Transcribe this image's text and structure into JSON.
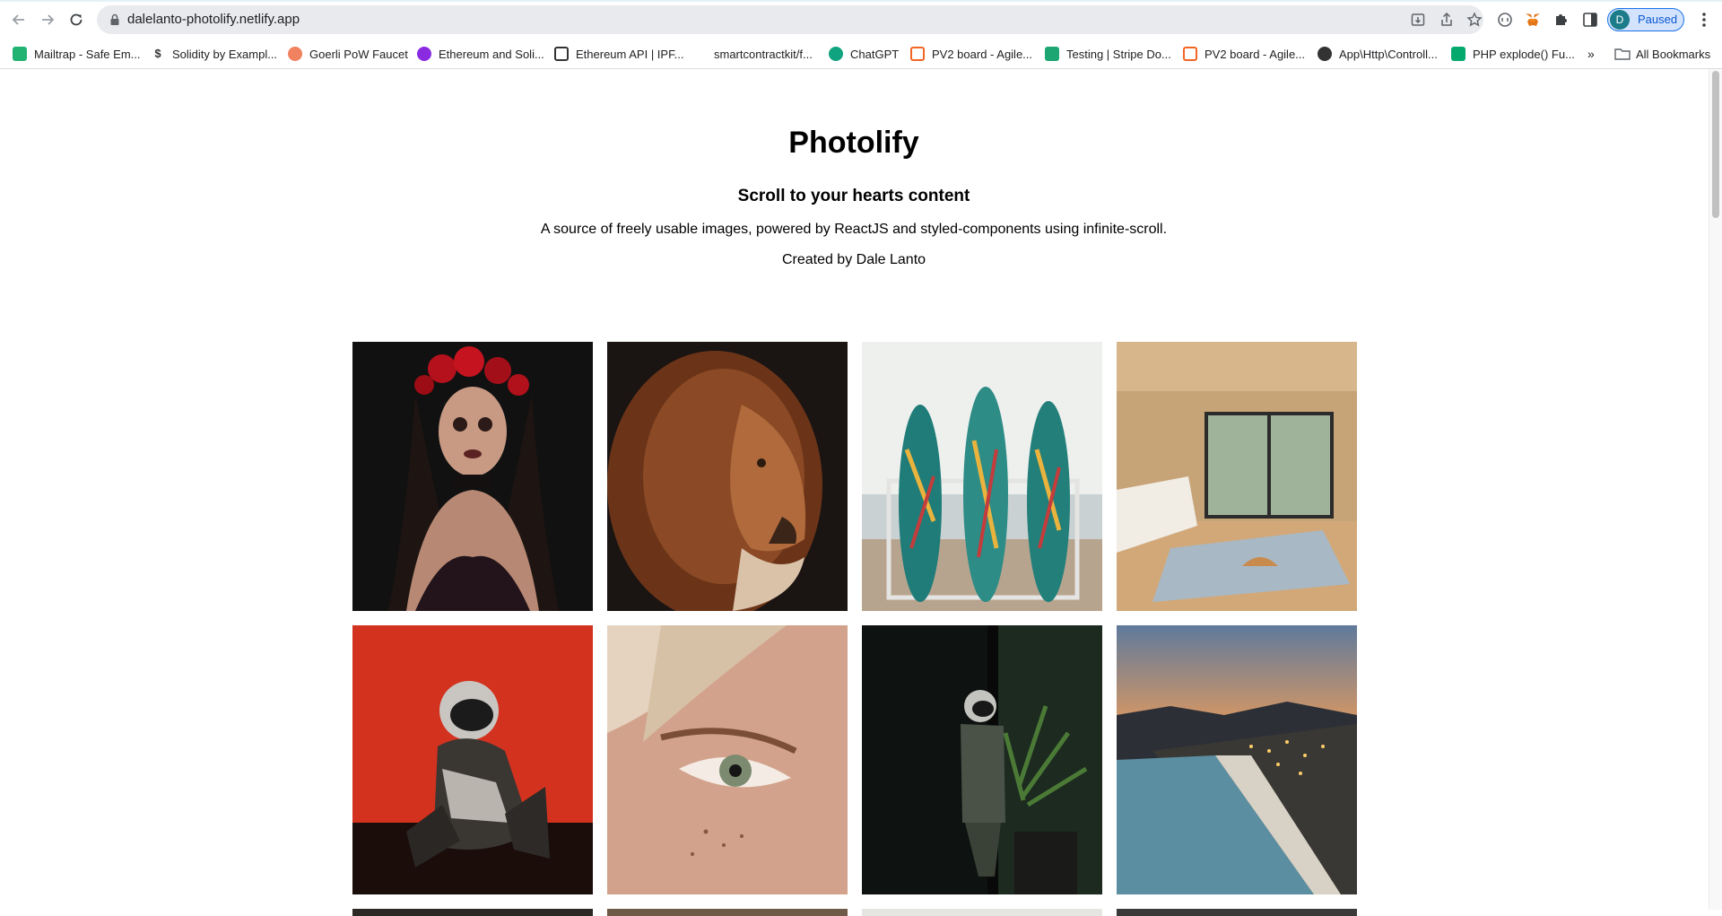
{
  "browser": {
    "url": "dalelanto-photolify.netlify.app",
    "profile_initial": "D",
    "profile_status": "Paused",
    "bookmarks": [
      {
        "label": "Mailtrap - Safe Em...",
        "icon": "mailtrap-icon",
        "color": "#22b373"
      },
      {
        "label": "Solidity by Exampl...",
        "icon": "dollar-icon",
        "color": "#333333"
      },
      {
        "label": "Goerli PoW Faucet",
        "icon": "drop-icon",
        "color": "#f08260"
      },
      {
        "label": "Ethereum and Soli...",
        "icon": "ethereum-icon",
        "color": "#8a2be2"
      },
      {
        "label": "Ethereum API | IPF...",
        "icon": "infura-icon",
        "color": "#333333"
      },
      {
        "label": "smartcontractkit/f...",
        "icon": "github-icon",
        "color": "#ffffff"
      },
      {
        "label": "ChatGPT",
        "icon": "chatgpt-icon",
        "color": "#10a37f"
      },
      {
        "label": "PV2 board - Agile...",
        "icon": "pivotal-icon",
        "color": "#f26522"
      },
      {
        "label": "Testing | Stripe Do...",
        "icon": "stripe-icon",
        "color": "#1ea672"
      },
      {
        "label": "PV2 board - Agile...",
        "icon": "pivotal-icon",
        "color": "#f26522"
      },
      {
        "label": "App\\Http\\Controll...",
        "icon": "globe-icon",
        "color": "#333333"
      },
      {
        "label": "PHP explode() Fu...",
        "icon": "w3schools-icon",
        "color": "#04aa6d"
      }
    ],
    "more_label": "»",
    "all_bookmarks": "All Bookmarks"
  },
  "page": {
    "title": "Photolify",
    "subtitle": "Scroll to your hearts content",
    "description": "A source of freely usable images, powered by ReactJS and styled-components using infinite-scroll.",
    "credit": "Created by Dale Lanto"
  },
  "gallery": {
    "images": [
      {
        "subject": "woman-skull-makeup-red-roses"
      },
      {
        "subject": "lion-portrait"
      },
      {
        "subject": "surfboards-on-beach"
      },
      {
        "subject": "wooden-living-room"
      },
      {
        "subject": "astronaut-red-background"
      },
      {
        "subject": "woman-eye-closeup"
      },
      {
        "subject": "astronaut-dark-room-plant"
      },
      {
        "subject": "coastline-city-lights-dusk"
      }
    ]
  },
  "colors": {
    "chrome_bg": "#ffffff",
    "omnibox_bg": "#e8eaed",
    "profile_accent": "#1a73e8",
    "page_bg": "#ffffff"
  }
}
